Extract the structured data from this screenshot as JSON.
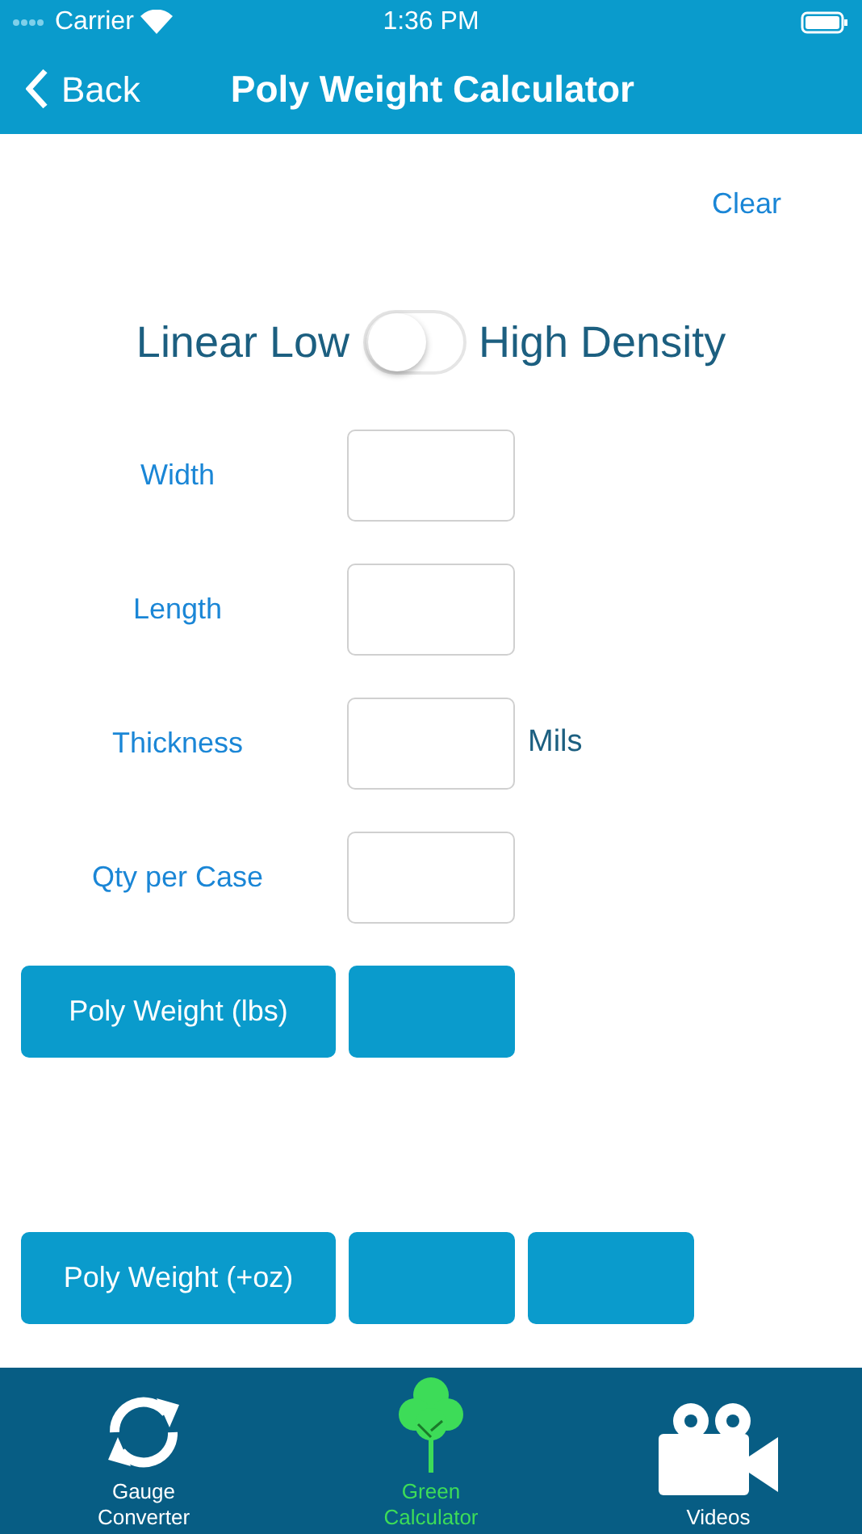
{
  "status_bar": {
    "carrier": "Carrier",
    "time": "1:36 PM"
  },
  "nav": {
    "back": "Back",
    "title": "Poly Weight Calculator"
  },
  "clear": "Clear",
  "switch": {
    "left_label": "Linear Low",
    "right_label": "High Density",
    "on": false
  },
  "fields": [
    {
      "label": "Width"
    },
    {
      "label": "Length"
    },
    {
      "label": "Thickness",
      "unit": "Mils"
    },
    {
      "label": "Qty per Case"
    }
  ],
  "results": [
    {
      "button": "Poly Weight (lbs)",
      "boxes": [
        {
          "kind": "output"
        }
      ]
    },
    {
      "button": "Poly Weight (+oz)",
      "boxes": [
        {
          "kind": "output"
        },
        {
          "kind": "output"
        }
      ]
    }
  ],
  "tabs": [
    {
      "label": "Gauge Converter",
      "kind": "refresh",
      "selected": false
    },
    {
      "label": "Green Calculator",
      "kind": "tree",
      "selected": true
    },
    {
      "label": "Videos",
      "kind": "camera",
      "selected": false
    }
  ]
}
